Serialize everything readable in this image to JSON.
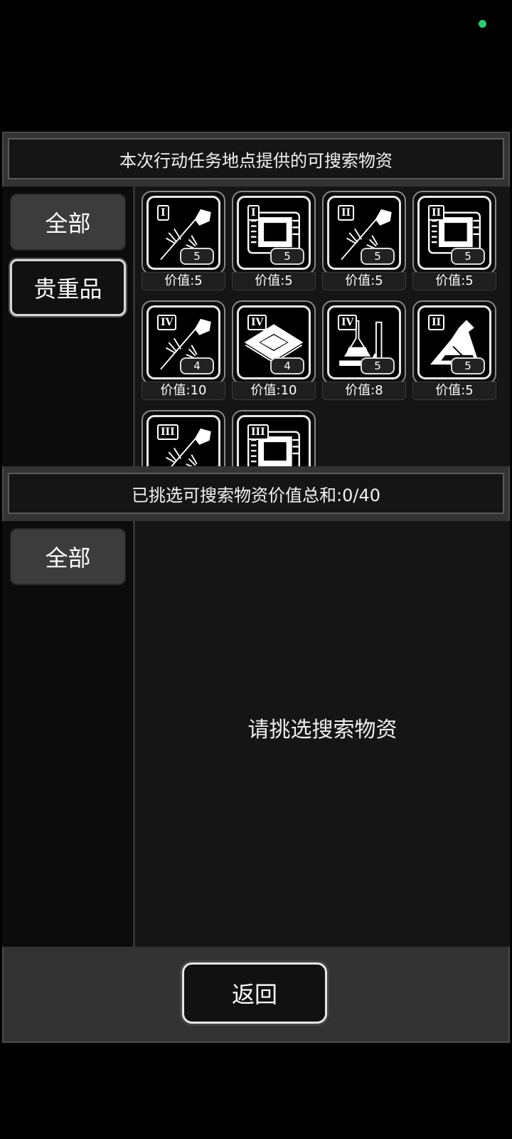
{
  "available": {
    "title": "本次行动任务地点提供的可搜索物资",
    "categories": [
      {
        "label": "全部",
        "selected": true
      },
      {
        "label": "贵重品",
        "selected": false
      }
    ],
    "items": [
      {
        "tier": "I",
        "icon": "cross-tool-icon",
        "qty": "5",
        "value": "价值:5"
      },
      {
        "tier": "I",
        "icon": "circuit-board-icon",
        "qty": "5",
        "value": "价值:5"
      },
      {
        "tier": "II",
        "icon": "cross-tool-icon",
        "qty": "5",
        "value": "价值:5"
      },
      {
        "tier": "II",
        "icon": "circuit-board-icon",
        "qty": "5",
        "value": "价值:5"
      },
      {
        "tier": "IV",
        "icon": "cross-tool-icon",
        "qty": "4",
        "value": "价值:10"
      },
      {
        "tier": "IV",
        "icon": "chip-icon",
        "qty": "4",
        "value": "价值:10"
      },
      {
        "tier": "IV",
        "icon": "lab-glassware-icon",
        "qty": "5",
        "value": "价值:8"
      },
      {
        "tier": "II",
        "icon": "flask-icon",
        "qty": "5",
        "value": "价值:5"
      },
      {
        "tier": "III",
        "icon": "cross-tool-icon",
        "qty": "",
        "value": ""
      },
      {
        "tier": "III",
        "icon": "circuit-board-icon",
        "qty": "",
        "value": ""
      }
    ]
  },
  "selected": {
    "title": "已挑选可搜索物资价值总和:0/40",
    "categories": [
      {
        "label": "全部",
        "selected": true
      }
    ],
    "empty_message": "请挑选搜索物资"
  },
  "footer": {
    "return_label": "返回"
  },
  "colors": {
    "status_dot": "#2ecc71",
    "panel_bg": "#151515",
    "frame": "#333333"
  }
}
